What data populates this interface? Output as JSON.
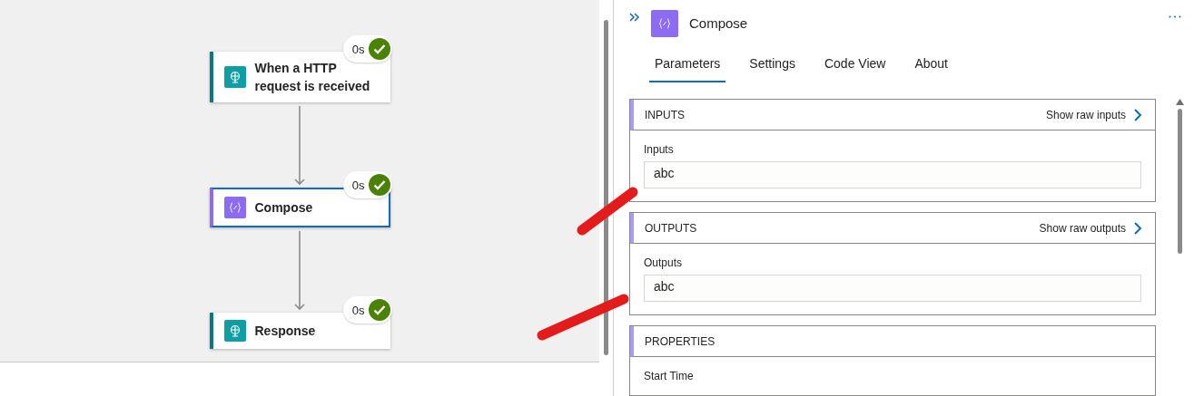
{
  "canvas": {
    "nodes": [
      {
        "title": "When a HTTP request is received",
        "kind": "http",
        "selected": false,
        "duration": "0s"
      },
      {
        "title": "Compose",
        "kind": "compose",
        "selected": true,
        "duration": "0s"
      },
      {
        "title": "Response",
        "kind": "http",
        "selected": false,
        "duration": "0s"
      }
    ]
  },
  "panel": {
    "title": "Compose",
    "kind": "compose",
    "tabs": [
      {
        "label": "Parameters",
        "selected": true
      },
      {
        "label": "Settings",
        "selected": false
      },
      {
        "label": "Code View",
        "selected": false
      },
      {
        "label": "About",
        "selected": false
      }
    ],
    "sections": [
      {
        "title": "INPUTS",
        "link": "Show raw inputs",
        "field_label": "Inputs",
        "value": "abc"
      },
      {
        "title": "OUTPUTS",
        "link": "Show raw outputs",
        "field_label": "Outputs",
        "value": "abc"
      },
      {
        "title": "PROPERTIES",
        "field_label": "Start Time"
      }
    ]
  }
}
